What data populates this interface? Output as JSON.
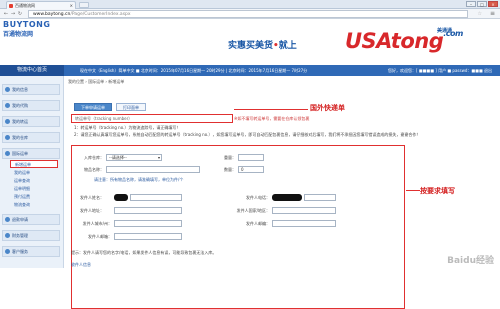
{
  "browser": {
    "tab_title": "百通物流网",
    "url_domain": "www.baytong.cn",
    "url_path": "/Page/CustomerIndex.aspx"
  },
  "header": {
    "brand": "BUYTONG",
    "brand_cn": "百通物流网",
    "slogan_left": "实惠买美货",
    "slogan_sep": "•",
    "slogan_right": "就上",
    "usatong": "USAtong",
    "usatong_com": ".com",
    "usatong_cn": "美通通"
  },
  "topbar": {
    "home_label": "物流中心首页",
    "info": "现在中文（English）简单中文 ■ 北京时间：2015年07月16日星期一 20时29分 | 北京时间：2015年7月16日星期一 7时27分",
    "user": "您好，欢迎您：[ ■■■■ ] 用户 ■ passwd：■■■ 退出"
  },
  "sidebar": {
    "items": [
      {
        "label": "我的信息"
      },
      {
        "label": "我的代购"
      },
      {
        "label": "我的转运"
      },
      {
        "label": "我的仓库"
      },
      {
        "label": "国际运单"
      },
      {
        "label": "退款申请"
      },
      {
        "label": "财务管理"
      },
      {
        "label": "客户服务"
      }
    ],
    "subs": [
      {
        "label": "新增运单"
      },
      {
        "label": "我的运单"
      },
      {
        "label": "运单查询"
      },
      {
        "label": "运单明细"
      },
      {
        "label": "预付运费"
      },
      {
        "label": "物流查询"
      }
    ]
  },
  "main": {
    "crumb": "我的位置 › 国际运单 › 新增运单",
    "tabs": [
      {
        "label": "下单申请运单"
      },
      {
        "label": "打印面单"
      }
    ],
    "tracking_placeholder": "转运单号（tracking number）",
    "tracking_hint": "※如不填写转运单号，需要在仓库认领包裹",
    "note1": "1：转运单号（tracking no.）为物流追踪号，请正确填写！",
    "note2": "2：请您正确认真填写您运单号，系统自动匹配您的转运单号（tracking no.），如您填写运单号，即可自动匹配包裹信息，请仔细核对后填写，我们将不承担因您填写错误造成的损失，谢谢合作！",
    "annotation_top": "国外快递单",
    "annotation_form": "按要求填写"
  },
  "form": {
    "warehouse_label": "入库仓库：",
    "warehouse_value": "--请选择--",
    "weight_label": "重量：",
    "goods_label": "物品名称：",
    "qty_label": "数量：",
    "qty_value": "0",
    "note_goods": "请注意：所有物品名称，请准确填写，单位为件/个",
    "sender_name_label": "发件人姓名：",
    "sender_phone_label": "发件人电话：",
    "sender_addr_label": "发件人地址：",
    "sender_country_label": "发件人国家/地区：",
    "sender_city_label": "发件人城市/州：",
    "sender_zip_label": "发件人邮编：",
    "sender_email_label": "发件人邮箱：",
    "footer_note": "提示：发件人请写您的名字/电话，如果发件人信息有误，可能导致包裹无法入库。",
    "link": "收件人信息"
  },
  "watermark": "Baidu经验"
}
